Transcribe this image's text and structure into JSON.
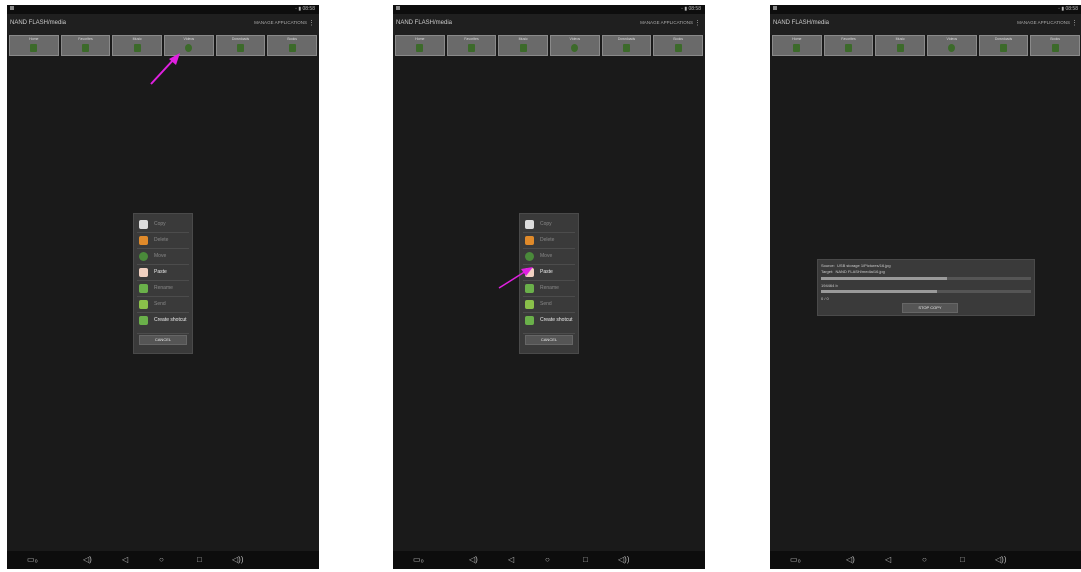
{
  "statusbar": {
    "icons": "◦ ▮ 08:58"
  },
  "actionbar": {
    "path": "NAND FLASH/media",
    "manage": "MANAGE APPLICATIONS",
    "more": "⋮"
  },
  "tabs": [
    "Home",
    "Favorites",
    "Music",
    "Videos",
    "Downloads",
    "Books"
  ],
  "tab_colors": {
    "bg": "#6a6a6a",
    "icon": "#3c6a2a"
  },
  "menu": {
    "items": [
      {
        "label": "Copy",
        "enabled": false,
        "icon": "copy-icon",
        "color": "#dddddd"
      },
      {
        "label": "Delete",
        "enabled": false,
        "icon": "delete-icon",
        "color": "#e08a2a"
      },
      {
        "label": "Move",
        "enabled": false,
        "icon": "move-icon",
        "color": "#4a8a3a"
      },
      {
        "label": "Paste",
        "enabled": true,
        "icon": "paste-icon",
        "color": "#f0d0c0"
      },
      {
        "label": "Rename",
        "enabled": false,
        "icon": "rename-icon",
        "color": "#6ab04a"
      },
      {
        "label": "Send",
        "enabled": false,
        "icon": "send-icon",
        "color": "#8ac04a"
      },
      {
        "label": "Create shotcut",
        "enabled": true,
        "icon": "pin-icon",
        "color": "#6ab04a"
      }
    ],
    "cancel": "CANCEL"
  },
  "copy_dialog": {
    "source_label": "Source:",
    "source_value": "USB storage 1/Pictures/16.jpg",
    "target_label": "Target:",
    "target_value": "NAND FLASH/media/16.jpg",
    "file_progress": 0.6,
    "size_label": "194464 b",
    "total_progress": 0.55,
    "count": "0 / 0",
    "stop_button": "STOP COPY"
  },
  "navbar": {
    "screenshot": "▭₀",
    "vol_down": "◁)",
    "back": "◁",
    "home": "○",
    "recents": "□",
    "vol_up": "◁))"
  },
  "annotation_color": "#e020e0"
}
